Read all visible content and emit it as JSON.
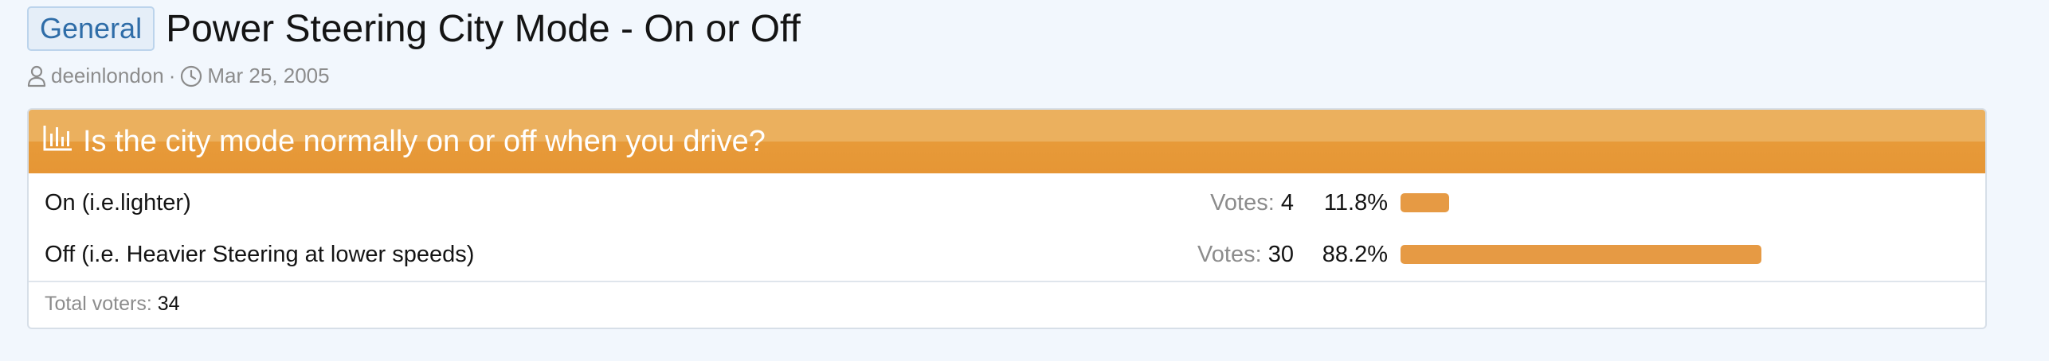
{
  "thread": {
    "prefix": "General",
    "title": "Power Steering City Mode - On or Off",
    "author": "deeinlondon",
    "separator": "·",
    "date": "Mar 25, 2005"
  },
  "poll": {
    "question": "Is the city mode normally on or off when you drive?",
    "options": [
      {
        "label": "On (i.e.lighter)",
        "votes_label": "Votes:",
        "votes": "4",
        "percent": "11.8%",
        "fraction": 0.118
      },
      {
        "label": "Off (i.e. Heavier Steering at lower speeds)",
        "votes_label": "Votes:",
        "votes": "30",
        "percent": "88.2%",
        "fraction": 0.882
      }
    ],
    "total_label": "Total voters:",
    "total": "34"
  },
  "colors": {
    "accent": "#e69635",
    "bar": "#e69a44",
    "prefix_text": "#2f6da8",
    "background": "#f2f7fd"
  },
  "icons": {
    "author": "user-icon",
    "date": "clock-icon",
    "poll": "bar-chart-icon"
  }
}
